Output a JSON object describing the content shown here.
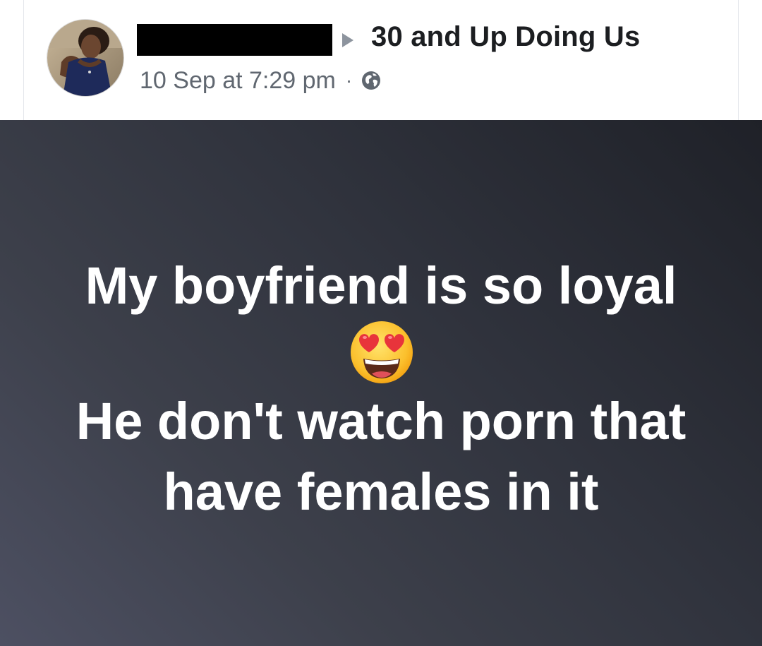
{
  "post": {
    "group_name": "30 and Up Doing Us",
    "timestamp": "10 Sep at 7:29 pm",
    "separator": "·",
    "privacy_icon": "globe-icon",
    "avatar_icon": "profile-photo",
    "author_name_redacted": true,
    "share_arrow_icon": "triangle-right-icon"
  },
  "text_post": {
    "line1": "My boyfriend is so loyal",
    "emoji_icon": "heart-eyes-emoji",
    "line2": "He don't watch porn that",
    "line3": "have females in it"
  },
  "colors": {
    "group_name": "#1c1e21",
    "meta_text": "#606770",
    "post_text": "#ffffff",
    "background_dark": "#1f2128",
    "background_light": "#4d5062"
  }
}
